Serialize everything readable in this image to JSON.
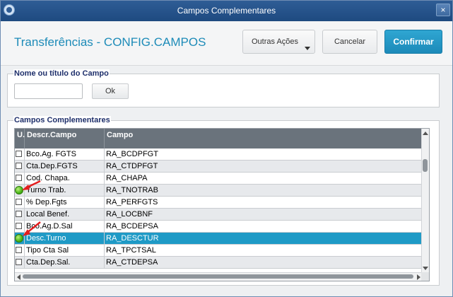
{
  "window": {
    "title": "Campos Complementares",
    "close_label": "×"
  },
  "header": {
    "page_title": "Transferências - CONFIG.CAMPOS",
    "outras_acoes_label": "Outras Ações",
    "cancelar_label": "Cancelar",
    "confirmar_label": "Confirmar",
    "accent_color": "#1d8bb8"
  },
  "nome_group": {
    "label": "Nome ou título do Campo",
    "input_value": "",
    "ok_label": "Ok"
  },
  "campos_group": {
    "label": "Campos Complementares",
    "columns": [
      "U.",
      "Descr.Campo",
      "Campo"
    ],
    "rows": [
      {
        "used": false,
        "desc": "Bco.Ag. FGTS",
        "campo": "RA_BCDPFGT",
        "selected": false
      },
      {
        "used": false,
        "desc": "Cta.Dep.FGTS",
        "campo": "RA_CTDPFGT",
        "selected": false
      },
      {
        "used": false,
        "desc": "Cod. Chapa.",
        "campo": "RA_CHAPA",
        "selected": false
      },
      {
        "used": true,
        "desc": "Turno Trab.",
        "campo": "RA_TNOTRAB",
        "selected": false
      },
      {
        "used": false,
        "desc": "% Dep.Fgts",
        "campo": "RA_PERFGTS",
        "selected": false
      },
      {
        "used": false,
        "desc": "Local Benef.",
        "campo": "RA_LOCBNF",
        "selected": false
      },
      {
        "used": false,
        "desc": "Bco.Ag.D.Sal",
        "campo": "RA_BCDEPSA",
        "selected": false
      },
      {
        "used": true,
        "desc": "Desc.Turno",
        "campo": "RA_DESCTUR",
        "selected": true
      },
      {
        "used": false,
        "desc": "Tipo Cta Sal",
        "campo": "RA_TPCTSAL",
        "selected": false
      },
      {
        "used": false,
        "desc": "Cta.Dep.Sal.",
        "campo": "RA_CTDEPSA",
        "selected": false
      }
    ],
    "selected_color": "#1f9ac6"
  },
  "icons": {
    "used_marker": "green-dot-icon",
    "unused_marker": "checkbox-icon",
    "annotation": "red-arrow-icon"
  }
}
